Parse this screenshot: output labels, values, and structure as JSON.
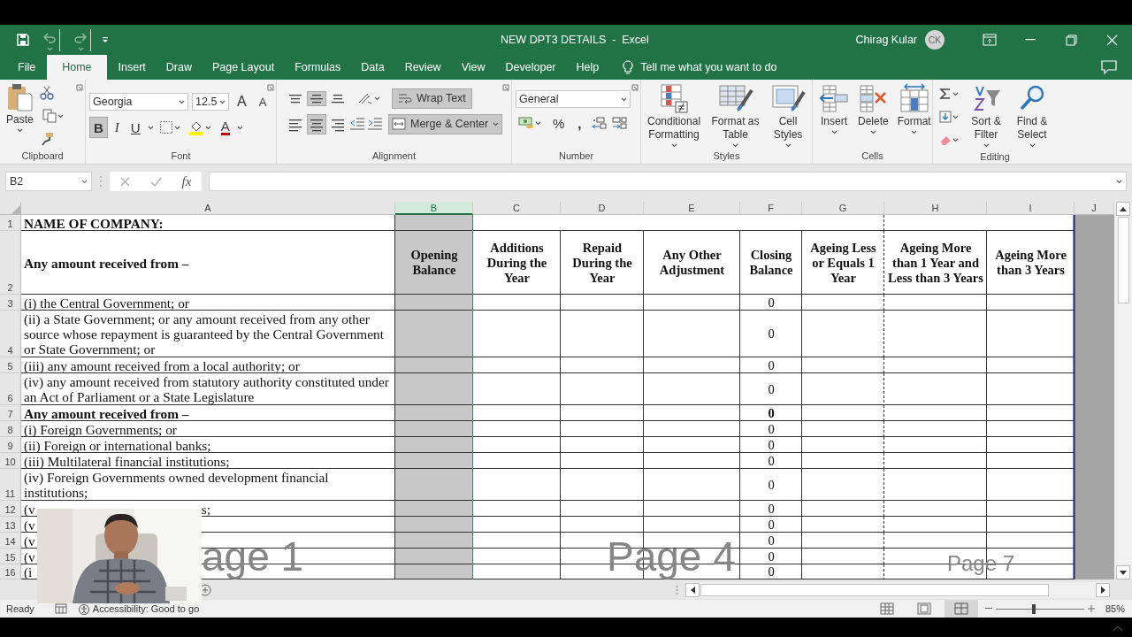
{
  "title_bar": {
    "title": "NEW DPT3 DETAILS  -  Excel",
    "user": "Chirag Kular",
    "avatar": "CK"
  },
  "tabs": [
    {
      "label": "File",
      "selected": false
    },
    {
      "label": "Home",
      "selected": true
    },
    {
      "label": "Insert",
      "selected": false
    },
    {
      "label": "Draw",
      "selected": false
    },
    {
      "label": "Page Layout",
      "selected": false
    },
    {
      "label": "Formulas",
      "selected": false
    },
    {
      "label": "Data",
      "selected": false
    },
    {
      "label": "Review",
      "selected": false
    },
    {
      "label": "View",
      "selected": false
    },
    {
      "label": "Developer",
      "selected": false
    },
    {
      "label": "Help",
      "selected": false
    }
  ],
  "tell_me": {
    "placeholder": "Tell me what you want to do"
  },
  "ribbon": {
    "clipboard": {
      "label": "Clipboard",
      "paste": "Paste"
    },
    "font": {
      "label": "Font",
      "name": "Georgia",
      "size": "12.5",
      "grow": "A",
      "shrink": "A",
      "styles": [
        {
          "kind": "bold",
          "label": "B",
          "on": true
        },
        {
          "kind": "italic",
          "label": "I",
          "on": false
        },
        {
          "kind": "underline",
          "label": "U",
          "on": false
        }
      ],
      "font_color": "A"
    },
    "alignment": {
      "label": "Alignment",
      "vertical": [
        {
          "kind": "top",
          "selected": false
        },
        {
          "kind": "middle",
          "selected": true
        },
        {
          "kind": "bottom",
          "selected": false
        }
      ],
      "horizontal": [
        {
          "kind": "left",
          "selected": false
        },
        {
          "kind": "center",
          "selected": true
        },
        {
          "kind": "right",
          "selected": false
        }
      ],
      "wrap_text": {
        "label": "Wrap Text",
        "on": true
      },
      "merge": {
        "label": "Merge & Center",
        "on": true
      }
    },
    "number": {
      "label": "Number",
      "format": "General",
      "percent": "%",
      "comma": ","
    },
    "styles": {
      "label": "Styles",
      "buttons": [
        {
          "kind": "conditional",
          "label": "Conditional Formatting"
        },
        {
          "kind": "table",
          "label": "Format as Table"
        },
        {
          "kind": "cell_styles",
          "label": "Cell Styles"
        }
      ]
    },
    "cells": {
      "label": "Cells",
      "buttons": [
        {
          "kind": "insert",
          "label": "Insert"
        },
        {
          "kind": "delete",
          "label": "Delete"
        },
        {
          "kind": "format",
          "label": "Format"
        }
      ]
    },
    "editing": {
      "label": "Editing",
      "buttons": [
        {
          "kind": "sort",
          "label": "Sort & Filter"
        },
        {
          "kind": "find",
          "label": "Find & Select"
        }
      ]
    }
  },
  "formula_bar": {
    "name_box": "B2",
    "fx": "fx"
  },
  "sheet": {
    "columns": [
      {
        "letter": "A",
        "selected": false
      },
      {
        "letter": "B",
        "selected": true
      },
      {
        "letter": "C",
        "selected": false
      },
      {
        "letter": "D",
        "selected": false
      },
      {
        "letter": "E",
        "selected": false
      },
      {
        "letter": "F",
        "selected": false
      },
      {
        "letter": "G",
        "selected": false
      },
      {
        "letter": "H",
        "selected": false
      },
      {
        "letter": "I",
        "selected": false
      },
      {
        "letter": "J",
        "selected": false
      }
    ],
    "rows": [
      {
        "number": "1",
        "bold": true,
        "label": "NAME OF COMPANY:"
      },
      {
        "number": "2",
        "bold": true,
        "label": "Any amount received from –",
        "headings": [
          "Opening Balance",
          "Additions During the Year",
          "Repaid During the Year",
          "Any Other Adjustment",
          "Closing Balance",
          "Ageing Less or Equals 1 Year",
          "Ageing More than 1 Year and Less than 3 Years",
          "Ageing More than 3 Years"
        ]
      },
      {
        "number": "3",
        "bold": false,
        "label": "(i) the Central Government; or",
        "closing_balance": "0"
      },
      {
        "number": "4",
        "bold": false,
        "label": "(ii) a State Government; or any amount received from any other source whose repayment is guaranteed by the Central Government or State Government; or",
        "closing_balance": "0"
      },
      {
        "number": "5",
        "bold": false,
        "label": "(iii) any amount received from a local authority; or",
        "closing_balance": "0"
      },
      {
        "number": "6",
        "bold": false,
        "label": "(iv) any amount received from statutory authority constituted under an Act of Parliament or a State Legislature",
        "closing_balance": "0"
      },
      {
        "number": "7",
        "bold": true,
        "label": "Any amount received from –",
        "closing_balance": "0"
      },
      {
        "number": "8",
        "bold": false,
        "label": "(i) Foreign Governments; or",
        "closing_balance": "0"
      },
      {
        "number": "9",
        "bold": false,
        "label": "(ii) Foreign or international banks;",
        "closing_balance": "0"
      },
      {
        "number": "10",
        "bold": false,
        "label": "(iii) Multilateral financial institutions;",
        "closing_balance": "0"
      },
      {
        "number": "11",
        "bold": false,
        "label": "(iv) Foreign Governments owned development financial institutions;",
        "closing_balance": "0"
      },
      {
        "number": "12",
        "bold": false,
        "label": "(v",
        "tail": "s;",
        "closing_balance": "0"
      },
      {
        "number": "13",
        "bold": false,
        "label": "(v",
        "closing_balance": "0"
      },
      {
        "number": "14",
        "bold": false,
        "label": "(v",
        "closing_balance": "0"
      },
      {
        "number": "15",
        "bold": false,
        "label": "(v",
        "closing_balance": "0"
      },
      {
        "number": "16",
        "bold": false,
        "label": "(i",
        "closing_balance": "0"
      }
    ],
    "page_labels": [
      "age 1",
      "Page 4",
      "Page 7"
    ]
  },
  "status_bar": {
    "status": "Ready",
    "accessibility": "Accessibility: Good to go",
    "views": [
      {
        "kind": "normal",
        "selected": false
      },
      {
        "kind": "page_layout",
        "selected": false
      },
      {
        "kind": "page_break",
        "selected": true
      }
    ],
    "zoom": {
      "level": 0.43,
      "reading": "85%"
    }
  }
}
